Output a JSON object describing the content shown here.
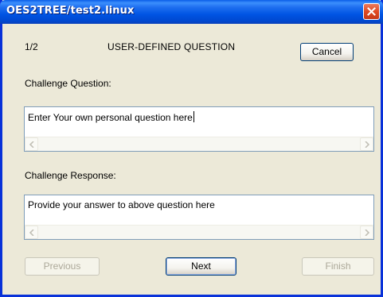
{
  "window": {
    "title": "OES2TREE/test2.linux"
  },
  "header": {
    "step": "1/2",
    "heading": "USER-DEFINED QUESTION",
    "cancel_label": "Cancel"
  },
  "question": {
    "label": "Challenge Question:",
    "value": "Enter Your own personal question here"
  },
  "response": {
    "label": "Challenge Response:",
    "value": "Provide your answer to above question here"
  },
  "footer": {
    "previous_label": "Previous",
    "next_label": "Next",
    "finish_label": "Finish"
  },
  "colors": {
    "titlebar": "#0054e3",
    "dialog_bg": "#ece9d8",
    "close_button": "#e04a23",
    "disabled_text": "#aca899"
  },
  "icons": {
    "close": "close-icon",
    "scroll_left": "arrow-left-icon",
    "scroll_right": "arrow-right-icon"
  }
}
